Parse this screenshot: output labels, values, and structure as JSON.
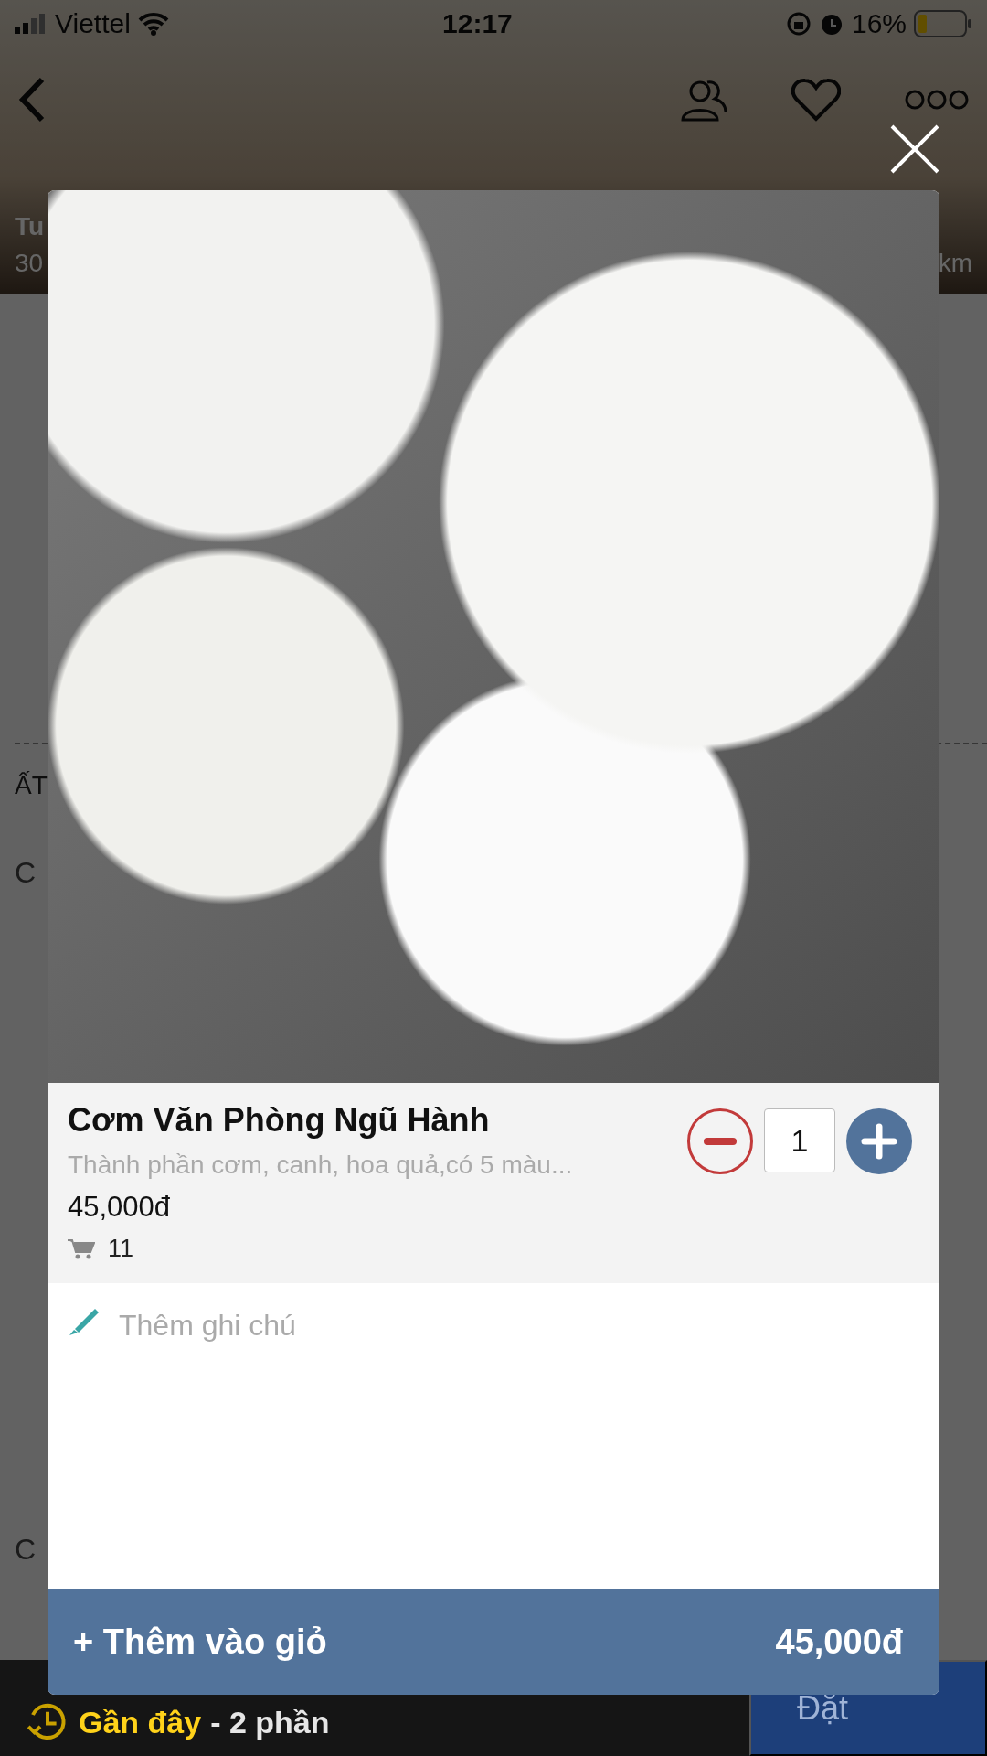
{
  "status_bar": {
    "carrier": "Viettel",
    "time": "12:17",
    "battery": "16%"
  },
  "background": {
    "title_fragment": "Tu",
    "distance_fragment": "30",
    "distance_unit_fragment": "km",
    "section_fragment": "ẤT",
    "row_fragments": [
      "C",
      "C"
    ],
    "recent_label": "Gần đây",
    "recent_count": "- 2 phần",
    "order_fragment": "Đặt"
  },
  "dish": {
    "name": "Cơm Văn Phòng Ngũ Hành",
    "description": "Thành phần cơm, canh, hoa quả,có 5 màu...",
    "price": "45,000đ",
    "sold_count": "11",
    "quantity": "1",
    "note_placeholder": "Thêm ghi chú"
  },
  "add_button": {
    "label": "+ Thêm vào giỏ",
    "total": "45,000đ"
  }
}
